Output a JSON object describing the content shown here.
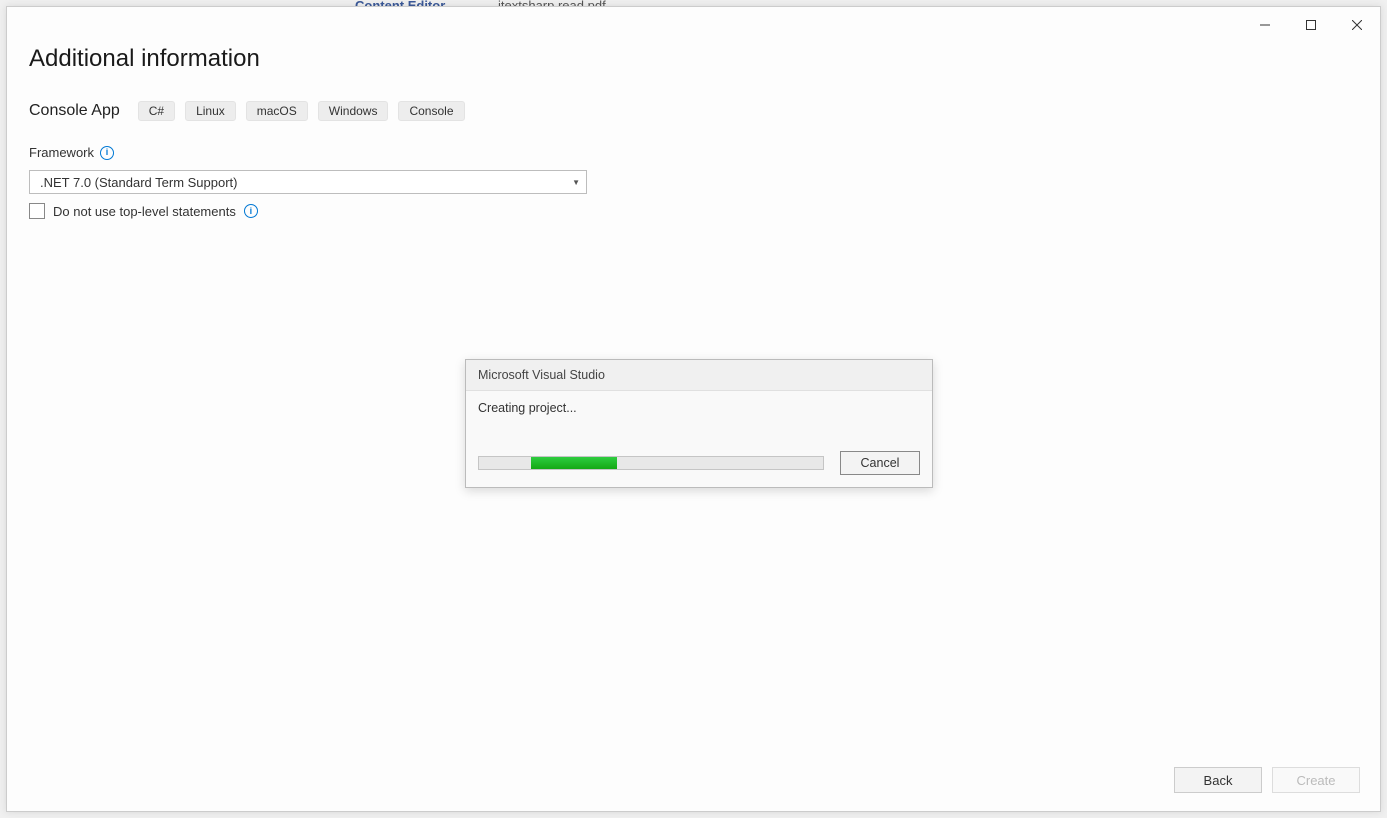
{
  "background": {
    "tab_label": "Content Editor",
    "filename": "itextsharp read pdf"
  },
  "window": {
    "title": "Additional information",
    "template_name": "Console App",
    "tags": [
      "C#",
      "Linux",
      "macOS",
      "Windows",
      "Console"
    ],
    "framework_label": "Framework",
    "framework_selected": ".NET 7.0 (Standard Term Support)",
    "checkbox_label": "Do not use top-level statements",
    "checkbox_checked": false,
    "buttons": {
      "back": "Back",
      "create": "Create"
    }
  },
  "modal": {
    "title": "Microsoft Visual Studio",
    "message": "Creating project...",
    "cancel": "Cancel",
    "progress_left_pct": 15,
    "progress_width_pct": 25
  }
}
